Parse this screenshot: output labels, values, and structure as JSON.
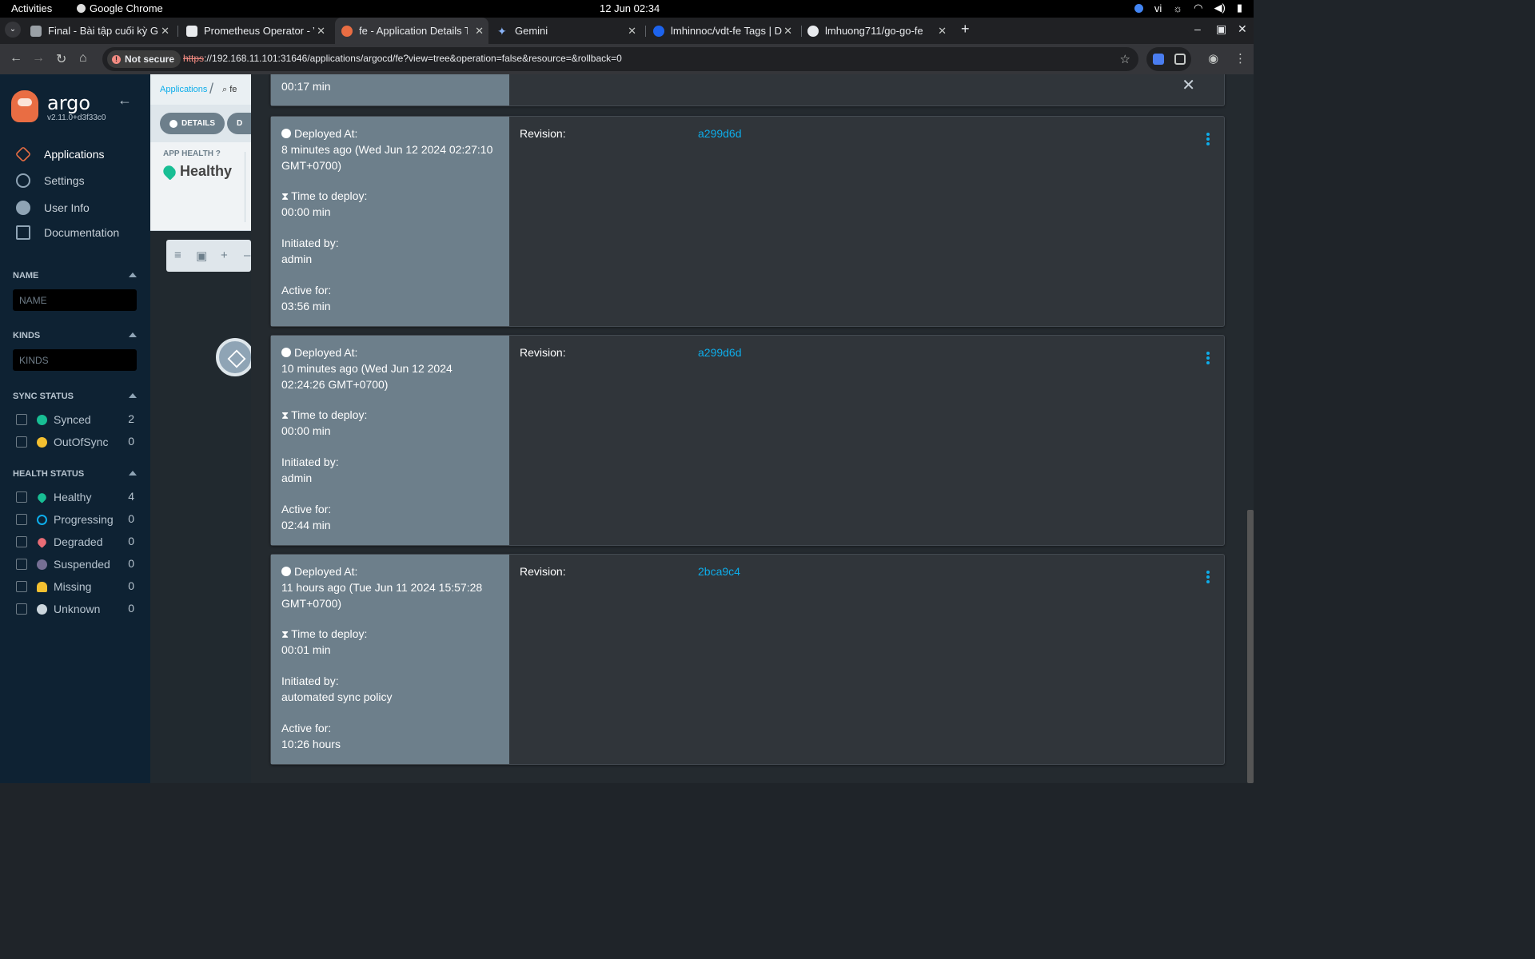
{
  "os": {
    "activities": "Activities",
    "app_name": "Google Chrome",
    "clock": "12 Jun  02:34",
    "lang": "vi"
  },
  "browser": {
    "tabs": [
      {
        "title": "Final - Bài tập cuối kỳ GĐ",
        "active": false
      },
      {
        "title": "Prometheus Operator - V",
        "active": false
      },
      {
        "title": "fe - Application Details T",
        "active": true
      },
      {
        "title": "Gemini",
        "active": false
      },
      {
        "title": "lmhinnoc/vdt-fe Tags | D",
        "active": false
      },
      {
        "title": "lmhuong711/go-go-fe",
        "active": false
      }
    ],
    "not_secure": "Not secure",
    "url_scheme": "https",
    "url_rest": "://192.168.11.101:31646/applications/argocd/fe?view=tree&operation=false&resource=&rollback=0"
  },
  "sidebar": {
    "brand": "argo",
    "version": "v2.11.0+d3f33c0",
    "nav": [
      {
        "label": "Applications"
      },
      {
        "label": "Settings"
      },
      {
        "label": "User Info"
      },
      {
        "label": "Documentation"
      }
    ],
    "name_header": "NAME",
    "name_placeholder": "NAME",
    "kinds_header": "KINDS",
    "kinds_placeholder": "KINDS",
    "sync_header": "SYNC STATUS",
    "sync": [
      {
        "label": "Synced",
        "count": "2"
      },
      {
        "label": "OutOfSync",
        "count": "0"
      }
    ],
    "health_header": "HEALTH STATUS",
    "health": [
      {
        "label": "Healthy",
        "count": "4"
      },
      {
        "label": "Progressing",
        "count": "0"
      },
      {
        "label": "Degraded",
        "count": "0"
      },
      {
        "label": "Suspended",
        "count": "0"
      },
      {
        "label": "Missing",
        "count": "0"
      },
      {
        "label": "Unknown",
        "count": "0"
      }
    ]
  },
  "main": {
    "breadcrumb_root": "Applications",
    "breadcrumb_app": "fe",
    "details_button": "DETAILS",
    "diff_button": "D",
    "app_health_label": "APP HEALTH",
    "app_health_value": "Healthy"
  },
  "history": {
    "top_active_value": "00:17 min",
    "deployed_label": "Deployed At:",
    "time_label": "Time to deploy:",
    "initiated_label": "Initiated by:",
    "active_label": "Active for:",
    "revision_label": "Revision:",
    "entries": [
      {
        "deployed": "8 minutes ago (Wed Jun 12 2024 02:27:10 GMT+0700)",
        "time": "00:00 min",
        "initiated": "admin",
        "active": "03:56 min",
        "revision": "a299d6d"
      },
      {
        "deployed": "10 minutes ago (Wed Jun 12 2024 02:24:26 GMT+0700)",
        "time": "00:00 min",
        "initiated": "admin",
        "active": "02:44 min",
        "revision": "a299d6d"
      },
      {
        "deployed": "11 hours ago (Tue Jun 11 2024 15:57:28 GMT+0700)",
        "time": "00:01 min",
        "initiated": "automated sync policy",
        "active": "10:26 hours",
        "revision": "2bca9c4"
      }
    ]
  },
  "colors": {
    "argo_accent": "#e96d43",
    "link": "#0dadea",
    "healthy": "#18be94",
    "sidebar_bg": "#0e2233"
  }
}
